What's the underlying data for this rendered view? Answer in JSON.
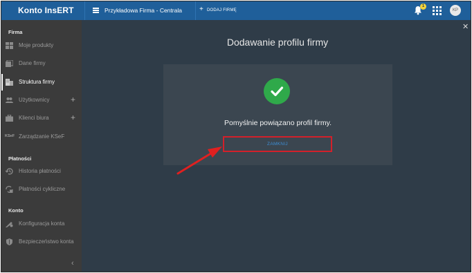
{
  "topbar": {
    "brand": "Konto InsERT",
    "company": "Przykładowa Firma - Centrala",
    "add_firm": "DODAJ FIRMĘ",
    "notification_count": "1",
    "avatar_initials": "KP"
  },
  "sidebar": {
    "sections": {
      "firma": "Firma",
      "platnosci": "Płatności",
      "konto": "Konto"
    },
    "items": [
      {
        "label": "Moje produkty",
        "icon": "products-icon"
      },
      {
        "label": "Dane firmy",
        "icon": "company-data-icon"
      },
      {
        "label": "Struktura firmy",
        "icon": "building-icon"
      },
      {
        "label": "Użytkownicy",
        "icon": "users-icon"
      },
      {
        "label": "Klienci biura",
        "icon": "briefcase-icon"
      },
      {
        "label": "Zarządzanie KSeF",
        "icon": "ksef-icon"
      },
      {
        "label": "Historia płatności",
        "icon": "history-icon"
      },
      {
        "label": "Płatności cykliczne",
        "icon": "recurring-icon"
      },
      {
        "label": "Konfiguracja konta",
        "icon": "settings-icon"
      },
      {
        "label": "Bezpieczeństwo konta",
        "icon": "shield-icon"
      }
    ],
    "ksef_badge": "KSeF"
  },
  "main": {
    "title": "Dodawanie profilu firmy",
    "message": "Pomyślnie powiązano profil firmy.",
    "close_button": "ZAMKNIJ"
  },
  "colors": {
    "topbar": "#1f5f9a",
    "sidebar": "#3b3b3b",
    "main_bg": "#2f3c48",
    "card_bg": "#3b4650",
    "success": "#2fa94a",
    "highlight": "#d3202a"
  }
}
